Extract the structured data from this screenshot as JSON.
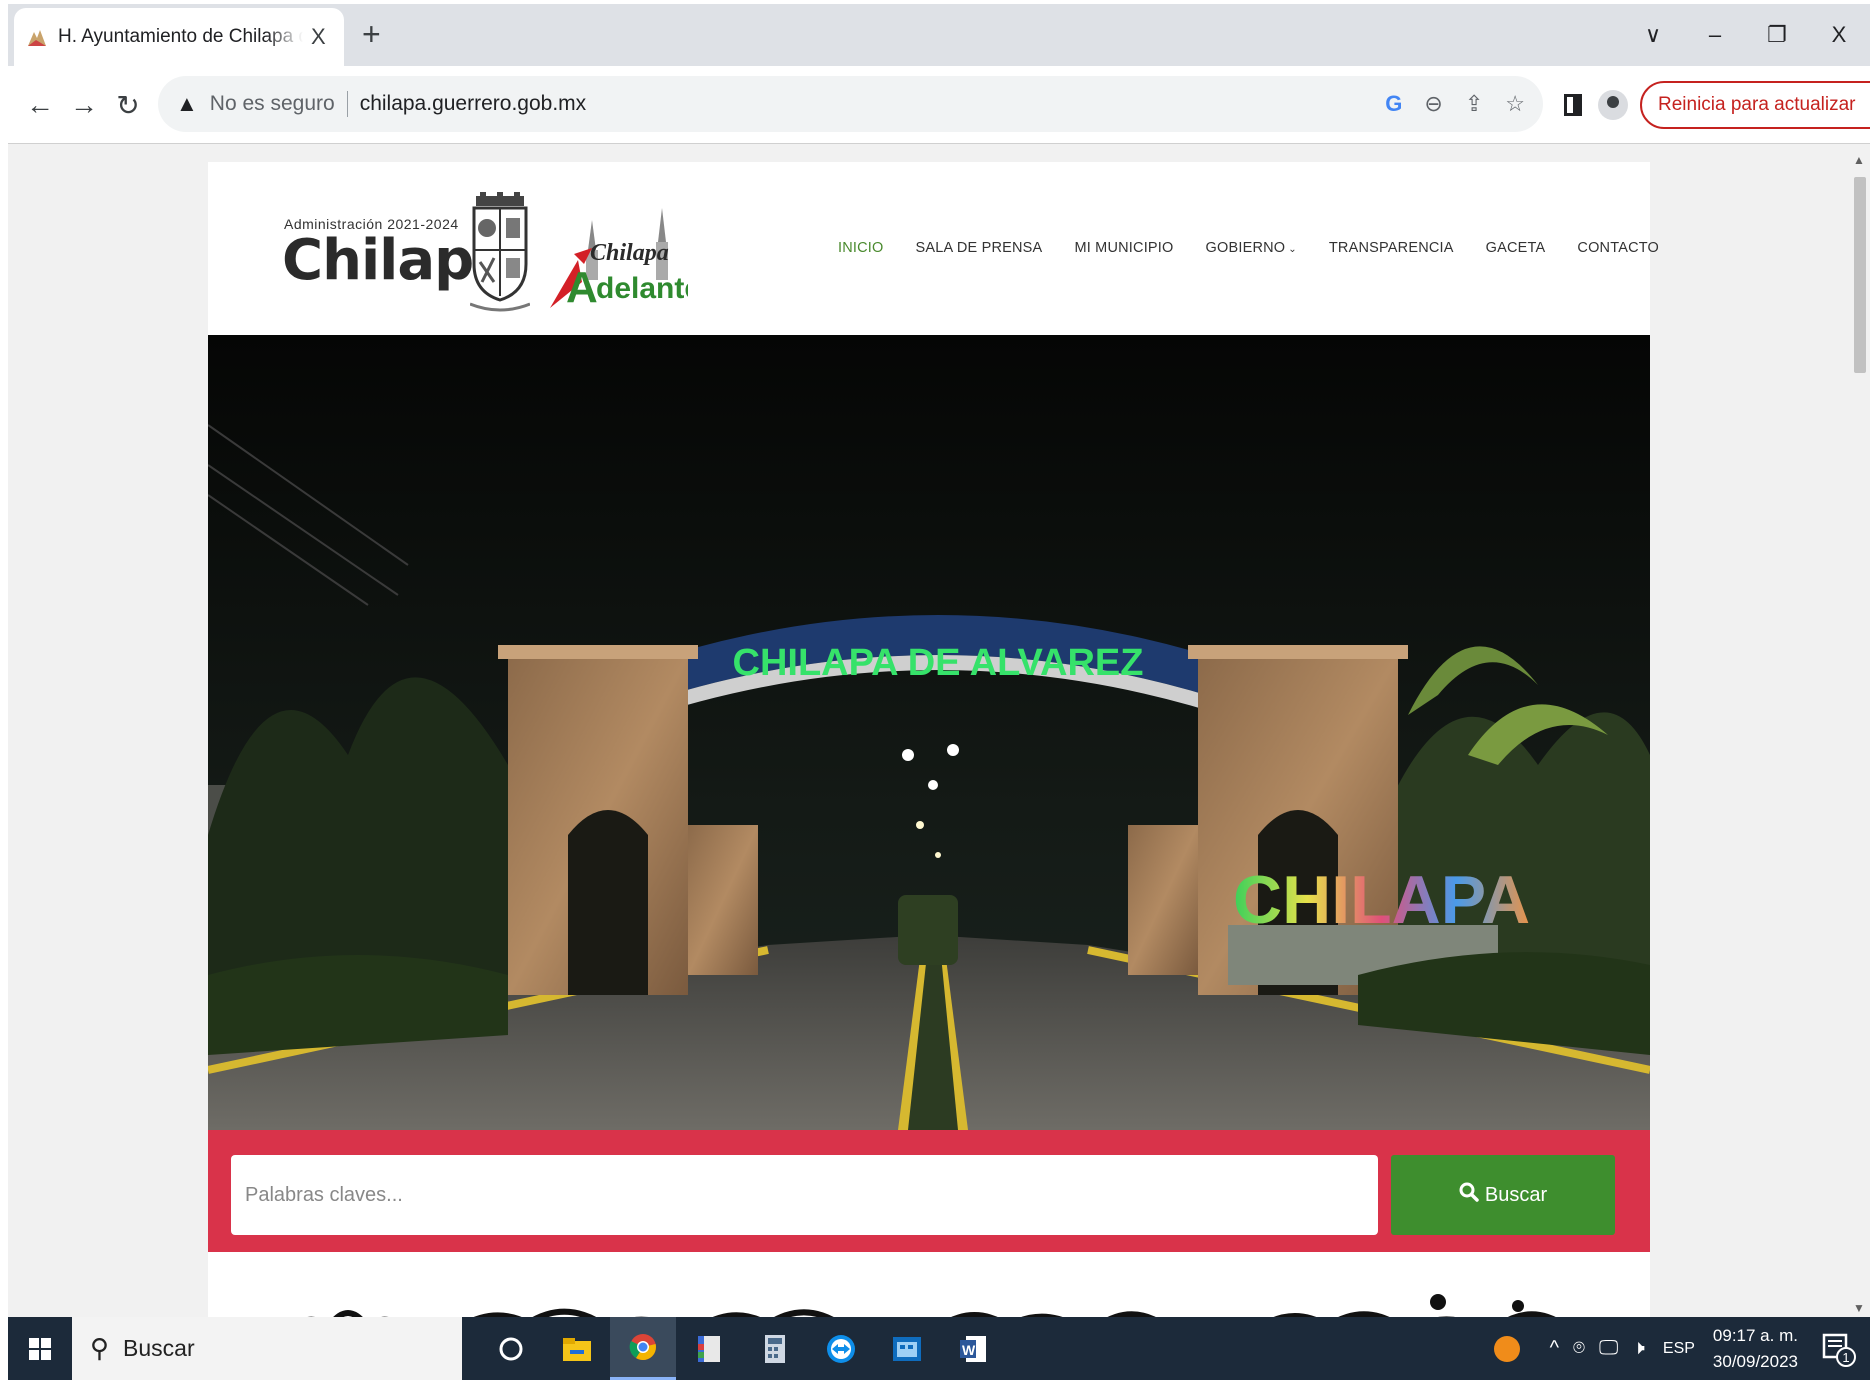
{
  "browser": {
    "tab_title": "H. Ayuntamiento de Chilapa de Álvarez",
    "tab_close": "X",
    "new_tab": "+",
    "window_controls": {
      "dropdown": "∨",
      "minimize": "–",
      "restore": "❐",
      "close": "X"
    },
    "security_label": "No es seguro",
    "url": "chilapa.guerrero.gob.mx",
    "update_button": "Reinicia para actualizar",
    "update_menu": "⋮"
  },
  "header": {
    "admin_label": "Administración 2021-2024",
    "logo_name": "Chilapa",
    "adelante_top": "Chilapa",
    "adelante_bottom": "delante",
    "adelante_letter": "A"
  },
  "nav": {
    "items": [
      {
        "label": "INICIO",
        "active": true
      },
      {
        "label": "SALA DE PRENSA"
      },
      {
        "label": "MI MUNICIPIO"
      },
      {
        "label": "GOBIERNO"
      },
      {
        "label": "TRANSPARENCIA"
      },
      {
        "label": "GACETA"
      },
      {
        "label": "CONTACTO"
      }
    ],
    "dropdown_chevron": "⌄"
  },
  "hero": {
    "arch_sign": "CHILAPA DE ALVAREZ",
    "letters_sign": "CHILAPA"
  },
  "search": {
    "placeholder": "Palabras claves...",
    "button_label": "Buscar"
  },
  "back_to_top": "↑",
  "taskbar": {
    "search_label": "Buscar",
    "language": "ESP",
    "time": "09:17 a. m.",
    "date": "30/09/2023",
    "notification_count": "1"
  },
  "colors": {
    "accent_green": "#3e8e2e",
    "nav_active": "#4a8a2e",
    "search_band": "#d9334a",
    "update_red": "#c5221f",
    "taskbar": "#1c2a3a"
  }
}
